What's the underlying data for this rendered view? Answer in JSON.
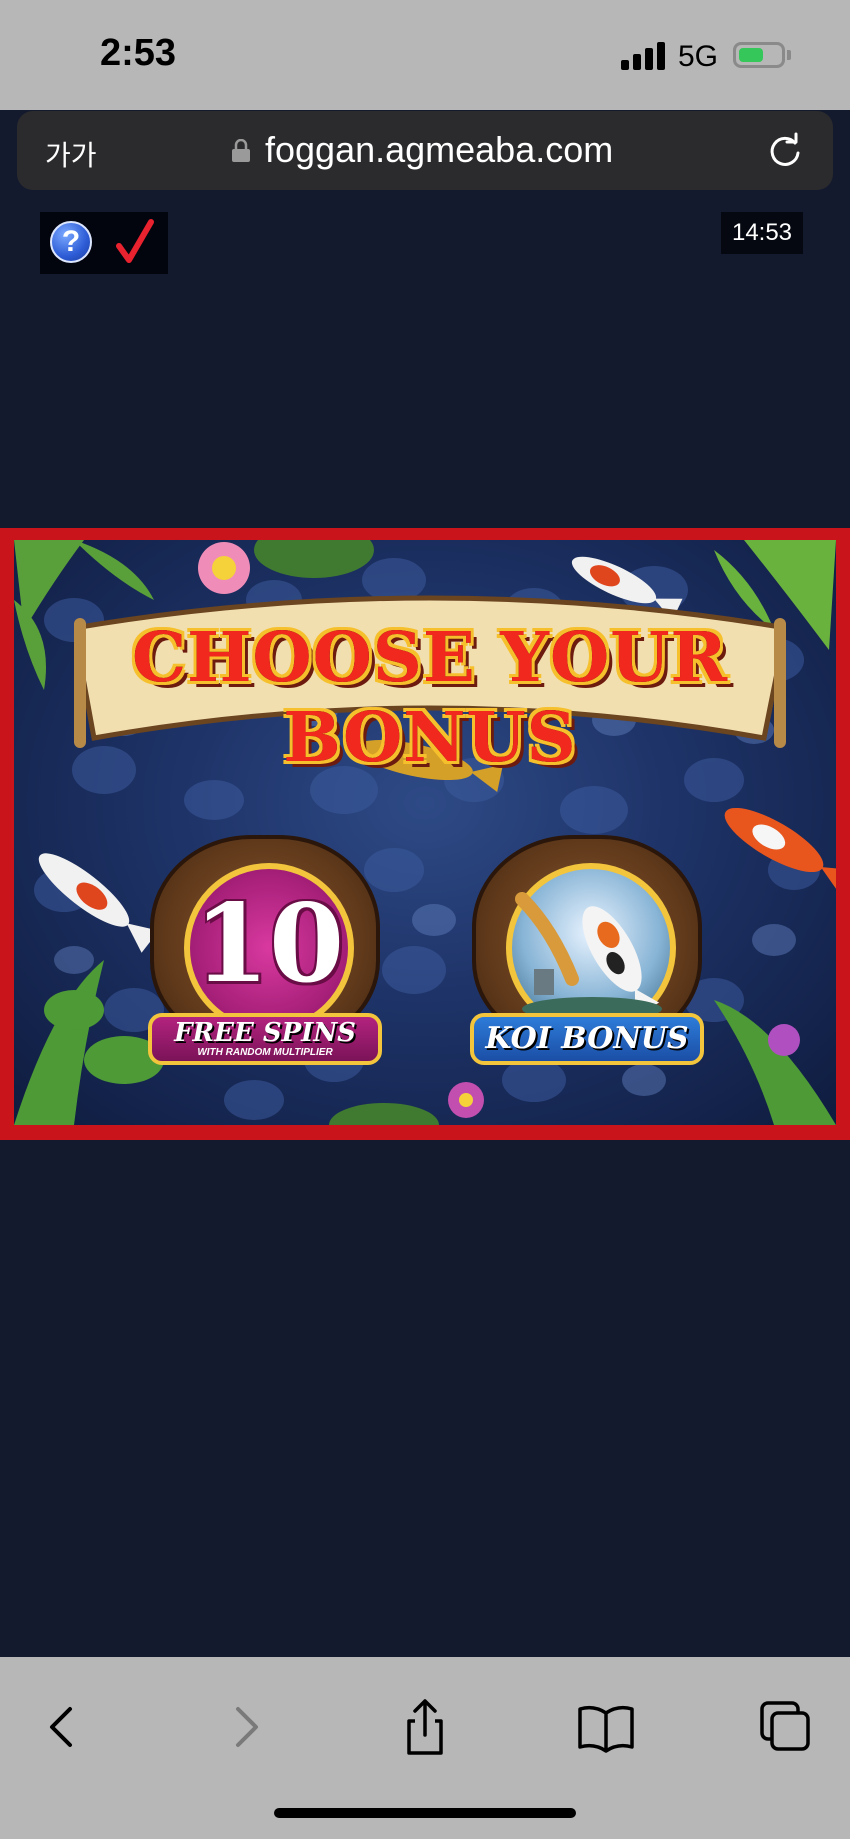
{
  "status_bar": {
    "time": "2:53",
    "network": "5G",
    "battery_level": 0.6
  },
  "browser": {
    "text_size_button": "가가",
    "url": "foggan.agmeaba.com"
  },
  "game_toolbar": {
    "help_icon": "question-icon",
    "check_icon": "checkmark-icon",
    "clock": "14:53"
  },
  "game": {
    "title": "CHOOSE YOUR BONUS",
    "options": [
      {
        "number": "10",
        "label": "FREE SPINS",
        "sublabel": "WITH RANDOM MULTIPLIER"
      },
      {
        "label": "KOI BONUS"
      }
    ]
  },
  "colors": {
    "frame_red": "#c8141a",
    "page_background": "#141a2e",
    "title_red": "#f0281e",
    "gold": "#f2c53d"
  }
}
